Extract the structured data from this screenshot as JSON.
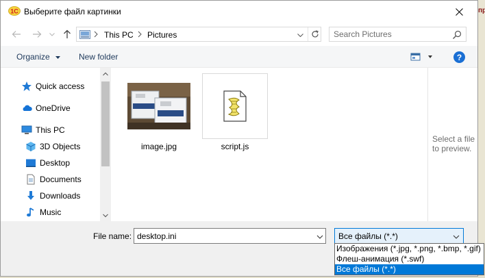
{
  "window": {
    "title": "Выберите файл картинки",
    "background_tab_text": "пра"
  },
  "address": {
    "crumbs": [
      "This PC",
      "Pictures"
    ]
  },
  "search": {
    "placeholder": "Search Pictures"
  },
  "toolbar": {
    "organize_label": "Organize",
    "new_folder_label": "New folder",
    "help_label": "?"
  },
  "sidebar": {
    "items": [
      {
        "label": "Quick access",
        "icon": "star-icon"
      },
      {
        "label": "OneDrive",
        "icon": "cloud-icon"
      },
      {
        "label": "This PC",
        "icon": "computer-icon"
      },
      {
        "label": "3D Objects",
        "icon": "cube-icon"
      },
      {
        "label": "Desktop",
        "icon": "desktop-icon"
      },
      {
        "label": "Documents",
        "icon": "document-icon"
      },
      {
        "label": "Downloads",
        "icon": "download-arrow-icon"
      },
      {
        "label": "Music",
        "icon": "music-note-icon"
      }
    ]
  },
  "files": [
    {
      "name": "image.jpg",
      "icon": "photo-thumbnail-icon"
    },
    {
      "name": "script.js",
      "icon": "script-file-icon"
    }
  ],
  "preview": {
    "text": "Select a file to preview."
  },
  "bottom": {
    "file_name_label": "File name:",
    "file_name_value": "desktop.ini",
    "file_type_value": "Все файлы (*.*)",
    "file_type_options": [
      "Изображения (*.jpg, *.png, *.bmp, *.gif)",
      "Флеш-анимация (*.swf)",
      "Все файлы (*.*)"
    ]
  },
  "colors": {
    "accent": "#0078d7",
    "help_button": "#1a6fd4",
    "link_text": "#1e395b"
  }
}
